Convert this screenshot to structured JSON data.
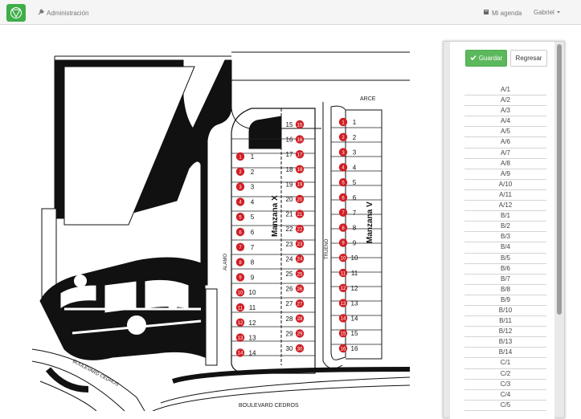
{
  "navbar": {
    "admin_label": "Administración",
    "agenda_label": "Mi agenda",
    "user_label": "Gabriel"
  },
  "panel": {
    "save_label": "Guardar",
    "back_label": "Regresar",
    "lots": [
      "A/1",
      "A/2",
      "A/3",
      "A/4",
      "A/5",
      "A/6",
      "A/7",
      "A/8",
      "A/9",
      "A/10",
      "A/11",
      "A/12",
      "B/1",
      "B/2",
      "B/3",
      "B/4",
      "B/5",
      "B/6",
      "B/7",
      "B/8",
      "B/9",
      "B/10",
      "B/11",
      "B/12",
      "B/13",
      "B/14",
      "C/1",
      "C/2",
      "C/3",
      "C/4",
      "C/5"
    ]
  },
  "map": {
    "streets": {
      "arce": "ARCE",
      "alamo": "ALAMO",
      "trueno": "TRUENO",
      "boulevard_1": "BOULEVARD CEDROS",
      "boulevard_2": "BOULEVARD CEDROS"
    },
    "manzana_x": "Manzana X",
    "manzana_v": "Manzana V",
    "left_lots_col1": [
      "1",
      "2",
      "3",
      "4",
      "5",
      "6",
      "7",
      "8",
      "9",
      "10",
      "11",
      "12",
      "13",
      "14"
    ],
    "left_lots_col2": [
      "15",
      "16",
      "17",
      "18",
      "19",
      "20",
      "21",
      "22",
      "23",
      "24",
      "25",
      "26",
      "27",
      "28",
      "29",
      "30"
    ],
    "right_lots": [
      "1",
      "2",
      "3",
      "4",
      "5",
      "6",
      "7",
      "8",
      "9",
      "10",
      "11",
      "12",
      "13",
      "14",
      "15",
      "16"
    ],
    "marker_color": "#d01f25"
  }
}
